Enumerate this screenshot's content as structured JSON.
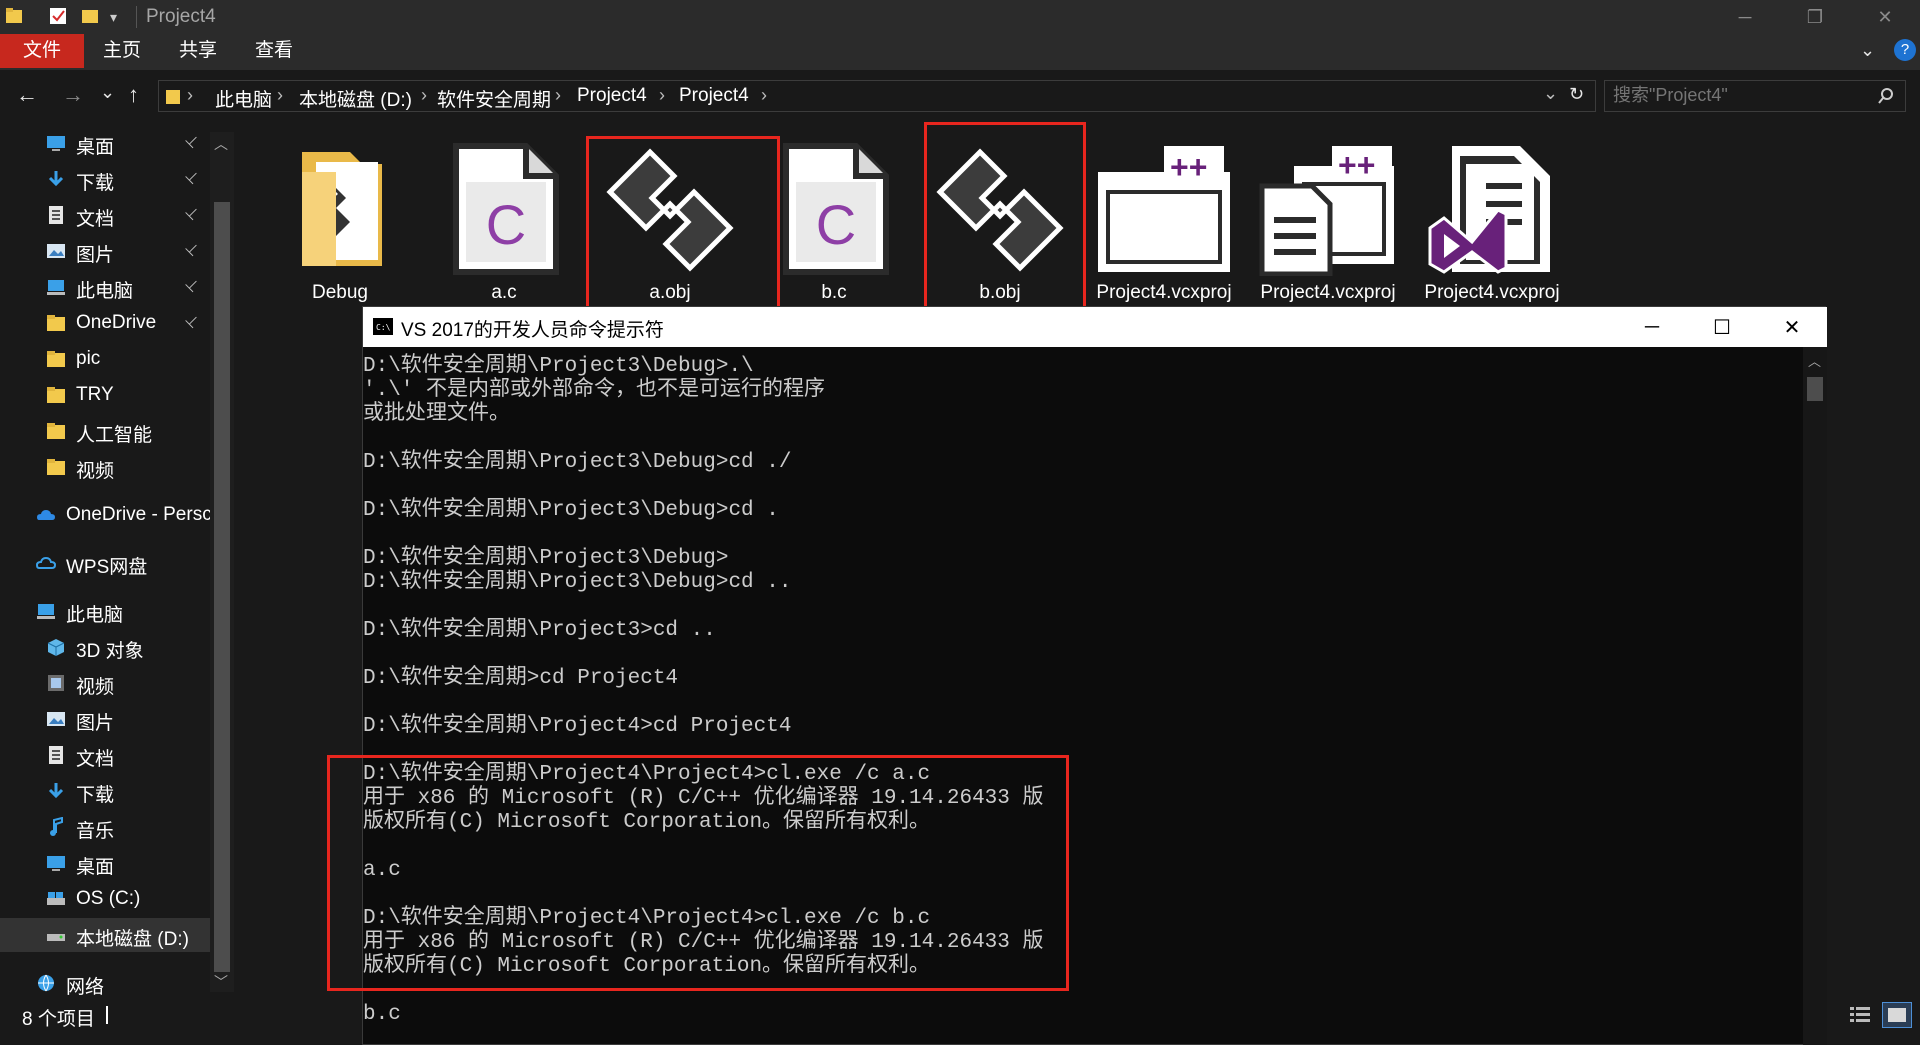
{
  "window": {
    "title": "Project4",
    "minimize": "─",
    "restore": "❐",
    "close": "✕"
  },
  "ribbon": {
    "tabs": [
      "文件",
      "主页",
      "共享",
      "查看"
    ]
  },
  "address": {
    "back": "←",
    "forward": "→",
    "recent": "⌄",
    "up": "↑",
    "crumbs": [
      "此电脑",
      "本地磁盘 (D:)",
      "软件安全周期",
      "Project4",
      "Project4"
    ],
    "sep": "›",
    "dropdown": "⌄",
    "refresh": "↻"
  },
  "search": {
    "placeholder": "搜索\"Project4\""
  },
  "nav": {
    "pin": "📌",
    "items": [
      {
        "label": "桌面",
        "icon": "desktop-icon"
      },
      {
        "label": "下载",
        "icon": "download-icon"
      },
      {
        "label": "文档",
        "icon": "document-icon"
      },
      {
        "label": "图片",
        "icon": "pictures-icon"
      },
      {
        "label": "此电脑",
        "icon": "computer-icon"
      },
      {
        "label": "OneDrive",
        "icon": "folder-icon"
      },
      {
        "label": "pic",
        "icon": "folder-icon"
      },
      {
        "label": "TRY",
        "icon": "folder-icon"
      },
      {
        "label": "人工智能",
        "icon": "folder-icon"
      },
      {
        "label": "视频",
        "icon": "folder-icon"
      },
      {
        "label": "OneDrive - Persc",
        "icon": "onedrive-cloud-icon"
      },
      {
        "label": "WPS网盘",
        "icon": "wps-cloud-icon"
      },
      {
        "label": "此电脑",
        "icon": "computer-icon"
      },
      {
        "label": "3D 对象",
        "icon": "3d-objects-icon"
      },
      {
        "label": "视频",
        "icon": "videos-icon"
      },
      {
        "label": "图片",
        "icon": "pictures-icon"
      },
      {
        "label": "文档",
        "icon": "document-icon"
      },
      {
        "label": "下载",
        "icon": "download-icon"
      },
      {
        "label": "音乐",
        "icon": "music-icon"
      },
      {
        "label": "桌面",
        "icon": "desktop-icon"
      },
      {
        "label": "OS (C:)",
        "icon": "drive-c-icon"
      },
      {
        "label": "本地磁盘 (D:)",
        "icon": "drive-d-icon"
      },
      {
        "label": "网络",
        "icon": "network-icon"
      }
    ]
  },
  "files": [
    {
      "name": "Debug",
      "icon": "folder-icon"
    },
    {
      "name": "a.c",
      "icon": "c-source-icon",
      "letter": "C"
    },
    {
      "name": "a.obj",
      "icon": "obj-file-icon"
    },
    {
      "name": "b.c",
      "icon": "c-source-icon",
      "letter": "C"
    },
    {
      "name": "b.obj",
      "icon": "obj-file-icon"
    },
    {
      "name": "Project4.vcxproj",
      "icon": "vcxproj-filters-icon"
    },
    {
      "name": "Project4.vcxproj",
      "icon": "vcxproj-user-icon"
    },
    {
      "name": "Project4.vcxproj",
      "icon": "visual-studio-project-icon"
    }
  ],
  "status": {
    "count": "8 个项目"
  },
  "console": {
    "title": "VS 2017的开发人员命令提示符",
    "lines": [
      "D:\\软件安全周期\\Project3\\Debug>.\\",
      "'.\\' 不是内部或外部命令，也不是可运行的程序",
      "或批处理文件。",
      "",
      "D:\\软件安全周期\\Project3\\Debug>cd ./",
      "",
      "D:\\软件安全周期\\Project3\\Debug>cd .",
      "",
      "D:\\软件安全周期\\Project3\\Debug>",
      "D:\\软件安全周期\\Project3\\Debug>cd ..",
      "",
      "D:\\软件安全周期\\Project3>cd ..",
      "",
      "D:\\软件安全周期>cd Project4",
      "",
      "D:\\软件安全周期\\Project4>cd Project4",
      "",
      "D:\\软件安全周期\\Project4\\Project4>cl.exe /c a.c",
      "用于 x86 的 Microsoft (R) C/C++ 优化编译器 19.14.26433 版",
      "版权所有(C) Microsoft Corporation。保留所有权利。",
      "",
      "a.c",
      "",
      "D:\\软件安全周期\\Project4\\Project4>cl.exe /c b.c",
      "用于 x86 的 Microsoft (R) C/C++ 优化编译器 19.14.26433 版",
      "版权所有(C) Microsoft Corporation。保留所有权利。",
      "",
      "b.c"
    ]
  },
  "colors": {
    "accent_red": "#c7281e",
    "highlight_box": "#e8261e",
    "c_letter": "#8e3fa6",
    "vs_purple": "#68217a",
    "folder": "#f2c94c"
  }
}
